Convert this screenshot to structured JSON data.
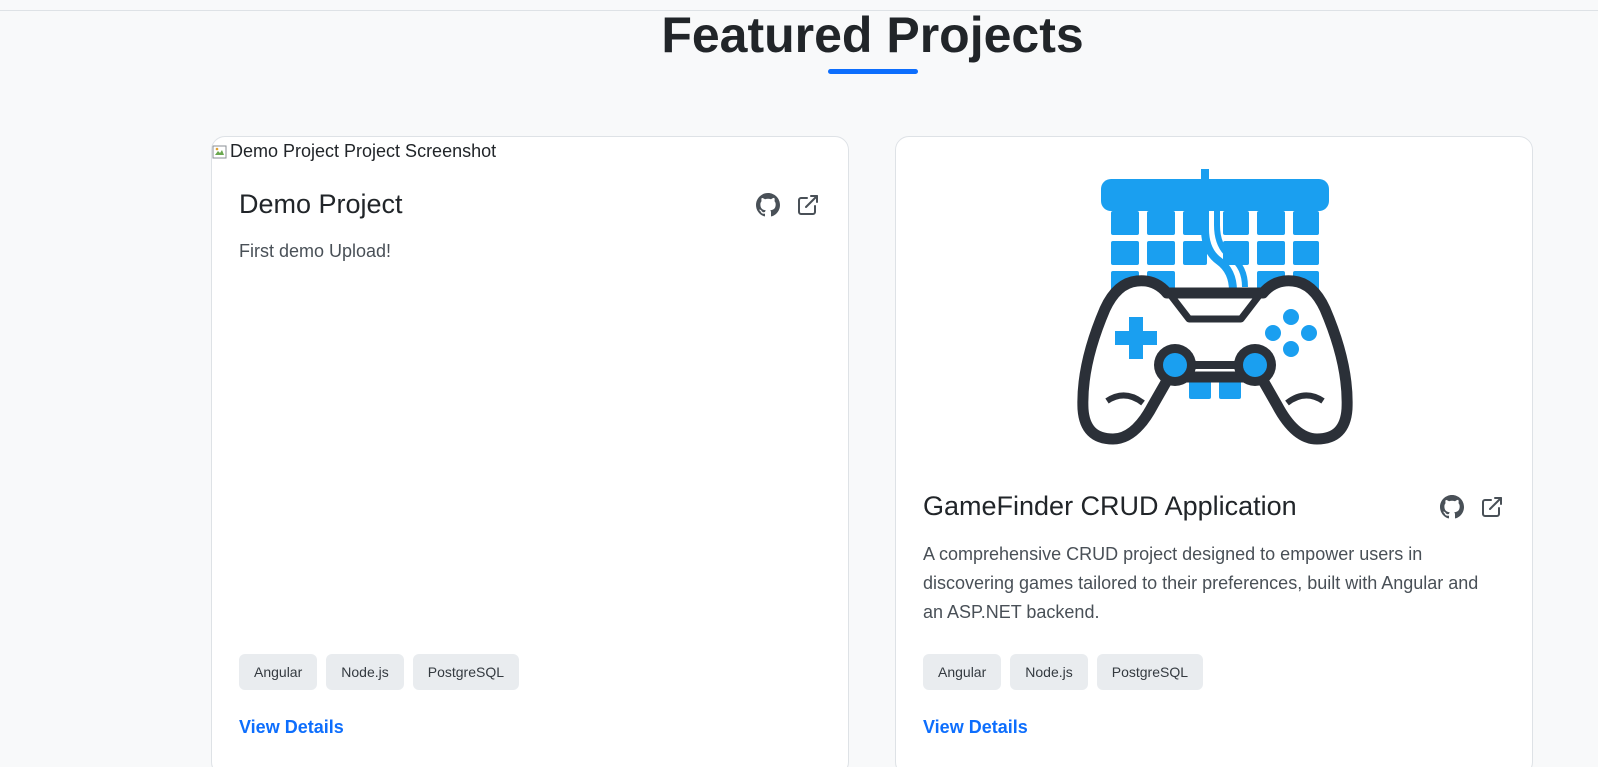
{
  "section": {
    "title": "Featured Projects"
  },
  "colors": {
    "accent": "#0d6efd",
    "controller_blue": "#1a9ff0",
    "controller_dark": "#2b3038",
    "tag_bg": "#e9ecef"
  },
  "projects": [
    {
      "image_alt": "Demo Project Project Screenshot",
      "title": "Demo Project",
      "description": "First demo Upload!",
      "icons": [
        "github-icon",
        "external-link-icon"
      ],
      "tags": [
        "Angular",
        "Node.js",
        "PostgreSQL"
      ],
      "link_label": "View Details"
    },
    {
      "image_alt": "",
      "image_icon": "game-controller-grid-icon",
      "title": "GameFinder CRUD Application",
      "description": "A comprehensive CRUD project designed to empower users in discovering games tailored to their preferences, built with Angular and an ASP.NET backend.",
      "icons": [
        "github-icon",
        "external-link-icon"
      ],
      "tags": [
        "Angular",
        "Node.js",
        "PostgreSQL"
      ],
      "link_label": "View Details"
    }
  ]
}
